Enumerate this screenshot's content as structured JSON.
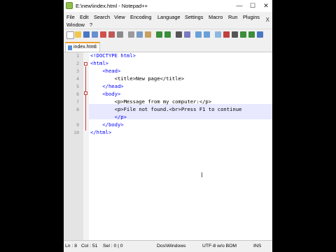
{
  "window": {
    "title": "E:\\new\\index.html - Notepad++",
    "minimize": "—",
    "maximize": "☐",
    "close": "✕"
  },
  "menu": {
    "items": [
      "File",
      "Edit",
      "Search",
      "View",
      "Encoding",
      "Language",
      "Settings",
      "Macro",
      "Run",
      "Plugins",
      "Window",
      "?"
    ],
    "close_glyph": "X"
  },
  "tab": {
    "label": "index.html",
    "close": "⊠"
  },
  "editor": {
    "lines": [
      {
        "num": "1",
        "text": "<!DOCTYPE html>"
      },
      {
        "num": "2",
        "text": "<html>"
      },
      {
        "num": "3",
        "text": "    <head>"
      },
      {
        "num": "4",
        "text": "        <title>New page</title>"
      },
      {
        "num": "5",
        "text": "    </head>"
      },
      {
        "num": "6",
        "text": "    <body>"
      },
      {
        "num": "7",
        "text": "        <p>Message from my computer:</p>"
      },
      {
        "num": "8",
        "text": "        <p>File not found.<br>Press F1 to continue"
      },
      {
        "num": "",
        "text": "        </p>"
      },
      {
        "num": "9",
        "text": "    </body>"
      },
      {
        "num": "10",
        "text": "</html>"
      }
    ],
    "cursor_glyph": "I"
  },
  "status": {
    "ln": "Ln : 8",
    "col": "Col : 51",
    "sel": "Sel : 0 | 0",
    "eol": "Dos\\Windows",
    "encoding": "UTF-8 w/o BOM",
    "mode": "INS"
  },
  "colors": {
    "background": "#000000",
    "tab_accent": "#f0a030",
    "current_line": "#e8e8ff",
    "tag": "#0000ff"
  }
}
